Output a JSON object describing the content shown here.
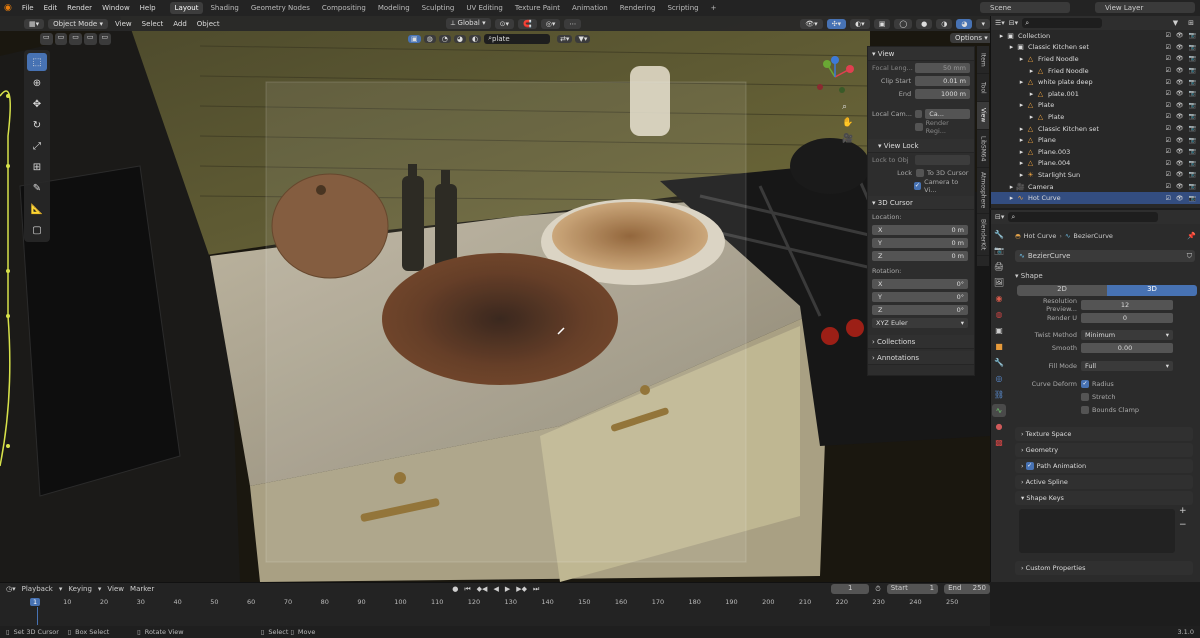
{
  "topbar": {
    "menus": [
      "File",
      "Edit",
      "Render",
      "Window",
      "Help"
    ],
    "workspaces": [
      "Layout",
      "Shading",
      "Geometry Nodes",
      "Compositing",
      "Modeling",
      "Sculpting",
      "UV Editing",
      "Texture Paint",
      "Animation",
      "Rendering",
      "Scripting"
    ],
    "active_workspace": "Layout",
    "scene_label": "Scene",
    "view_layer_label": "View Layer"
  },
  "viewport_header": {
    "mode": "Object Mode",
    "menus": [
      "View",
      "Select",
      "Add",
      "Object"
    ],
    "orientation": "Global",
    "search_value": "plate",
    "options_label": "Options"
  },
  "npanel": {
    "view_title": "View",
    "focal_length_label": "Focal Leng...",
    "focal_length_value": "50 mm",
    "clip_start_label": "Clip Start",
    "clip_start_value": "0.01 m",
    "end_label": "End",
    "end_value": "1000 m",
    "local_camera_label": "Local Cam...",
    "local_camera_value": "Ca...",
    "render_region_label": "Render Regi...",
    "view_lock_title": "View Lock",
    "lock_to_object_label": "Lock to Obj",
    "lock_label": "Lock",
    "to_3d_cursor_label": "To 3D Cursor",
    "camera_to_view_label": "Camera to Vi...",
    "cursor_title": "3D Cursor",
    "location_label": "Location:",
    "loc": [
      {
        "axis": "X",
        "value": "0 m"
      },
      {
        "axis": "Y",
        "value": "0 m"
      },
      {
        "axis": "Z",
        "value": "0 m"
      }
    ],
    "rotation_label": "Rotation:",
    "rot": [
      {
        "axis": "X",
        "value": "0°"
      },
      {
        "axis": "Y",
        "value": "0°"
      },
      {
        "axis": "Z",
        "value": "0°"
      }
    ],
    "rotation_mode": "XYZ Euler",
    "collections_title": "Collections",
    "annotations_title": "Annotations"
  },
  "side_tabs": [
    "Item",
    "Tool",
    "View",
    "LibSM64",
    "Atmosphere",
    "BlenderKit"
  ],
  "active_side_tab": "View",
  "outliner": {
    "search_placeholder": "",
    "rows": [
      {
        "label": "Collection",
        "indent": 0,
        "icon": "collection-icon"
      },
      {
        "label": "Classic Kitchen set",
        "indent": 1,
        "icon": "collection-icon"
      },
      {
        "label": "Fried Noodle",
        "indent": 2,
        "icon": "mesh-icon"
      },
      {
        "label": "Fried Noodle",
        "indent": 3,
        "icon": "mesh-icon"
      },
      {
        "label": "white plate deep",
        "indent": 2,
        "icon": "mesh-icon"
      },
      {
        "label": "plate.001",
        "indent": 3,
        "icon": "mesh-icon"
      },
      {
        "label": "Plate",
        "indent": 2,
        "icon": "mesh-icon"
      },
      {
        "label": "Plate",
        "indent": 3,
        "icon": "mesh-icon"
      },
      {
        "label": "Classic Kitchen set",
        "indent": 2,
        "icon": "mesh-icon"
      },
      {
        "label": "Plane",
        "indent": 2,
        "icon": "mesh-icon"
      },
      {
        "label": "Plane.003",
        "indent": 2,
        "icon": "mesh-icon"
      },
      {
        "label": "Plane.004",
        "indent": 2,
        "icon": "mesh-icon"
      },
      {
        "label": "Starlight Sun",
        "indent": 2,
        "icon": "light-icon"
      },
      {
        "label": "Camera",
        "indent": 1,
        "icon": "camera-icon"
      },
      {
        "label": "Hot Curve",
        "indent": 1,
        "icon": "curve-icon",
        "selected": true
      }
    ]
  },
  "properties": {
    "object_name": "Hot Curve",
    "data_name": "BezierCurve",
    "datablock_name": "BezierCurve",
    "shape_title": "Shape",
    "dim_2d": "2D",
    "dim_3d": "3D",
    "resolution_preview_label": "Resolution Preview...",
    "resolution_preview_value": "12",
    "render_u_label": "Render U",
    "render_u_value": "0",
    "twist_method_label": "Twist Method",
    "twist_method_value": "Minimum",
    "smooth_label": "Smooth",
    "smooth_value": "0.00",
    "fill_mode_label": "Fill Mode",
    "fill_mode_value": "Full",
    "curve_deform_label": "Curve Deform",
    "radius_label": "Radius",
    "stretch_label": "Stretch",
    "bounds_clamp_label": "Bounds Clamp",
    "sections": [
      "Texture Space",
      "Geometry",
      "Path Animation",
      "Active Spline",
      "Shape Keys"
    ],
    "custom_properties": "Custom Properties"
  },
  "timeline": {
    "menus": [
      "Playback",
      "Keying",
      "View",
      "Marker"
    ],
    "current_frame": "1",
    "start_label": "Start",
    "start_value": "1",
    "end_label": "End",
    "end_value": "250",
    "ticks": [
      "1",
      "10",
      "20",
      "30",
      "40",
      "50",
      "60",
      "70",
      "80",
      "90",
      "100",
      "110",
      "120",
      "130",
      "140",
      "150",
      "160",
      "170",
      "180",
      "190",
      "200",
      "210",
      "220",
      "230",
      "240",
      "250"
    ]
  },
  "statusbar": {
    "items": [
      "Set 3D Cursor",
      "Box Select",
      "Rotate View",
      "Select",
      "Move"
    ],
    "version": "3.1.0"
  },
  "colors": {
    "accent": "#4772b3",
    "selection": "#334d80"
  }
}
